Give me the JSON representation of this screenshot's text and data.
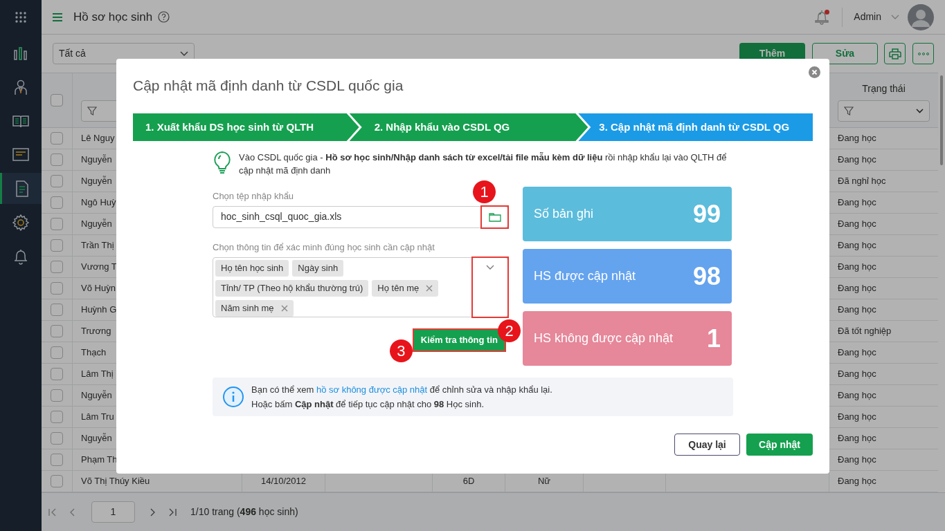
{
  "sidebar": {
    "items": [
      {
        "kind": "chart",
        "selected": false
      },
      {
        "kind": "person",
        "selected": false
      },
      {
        "kind": "book",
        "selected": false
      },
      {
        "kind": "screen",
        "selected": false
      },
      {
        "kind": "document",
        "selected": true
      },
      {
        "kind": "gear",
        "selected": false
      },
      {
        "kind": "bell",
        "selected": false
      }
    ]
  },
  "header": {
    "title": "Hồ sơ học sinh",
    "has_notification": true,
    "user": "Admin"
  },
  "toolbar": {
    "filter": "Tất cả",
    "buttons": [
      {
        "label": "Thêm",
        "primary": true
      },
      {
        "label": "Sửa",
        "primary": false
      }
    ]
  },
  "table": {
    "status_header": "Trạng thái",
    "select_all_checked": false,
    "rows_checked": false,
    "rows": [
      {
        "name": "Lê Nguy",
        "status": "Đang học"
      },
      {
        "name": "Nguyễn",
        "status": "Đang học"
      },
      {
        "name": "Nguyễn",
        "status": "Đã nghỉ học"
      },
      {
        "name": "Ngô Huỳ",
        "status": "Đang học"
      },
      {
        "name": "Nguyễn",
        "status": "Đang học"
      },
      {
        "name": "Trần Thị",
        "status": "Đang học"
      },
      {
        "name": "Vương T",
        "status": "Đang học"
      },
      {
        "name": "Võ Huỳn",
        "status": "Đang học"
      },
      {
        "name": "Huỳnh G",
        "status": "Đang học"
      },
      {
        "name": "Trương",
        "status": "Đã tốt nghiệp"
      },
      {
        "name": "Thạch",
        "status": "Đang học"
      },
      {
        "name": "Lâm Thị",
        "status": "Đang học"
      },
      {
        "name": "Nguyễn",
        "status": "Đang học"
      },
      {
        "name": "Lâm Tru",
        "status": "Đang học"
      },
      {
        "name": "Nguyễn",
        "status": "Đang học"
      },
      {
        "name": "Phạm Th",
        "status": "Đang học"
      },
      {
        "name": "Võ Thị Thúy Kiều",
        "birth_date": "14/10/2012",
        "class": "6D",
        "gender": "Nữ",
        "status": "Đang học"
      }
    ]
  },
  "pagination": {
    "page": "1",
    "summary": "1/10 trang (**496** học sinh)"
  },
  "dialog": {
    "title": "Cập nhật mã định danh từ CSDL quốc gia",
    "steps": [
      {
        "label": "1. Xuất khẩu DS học sinh từ QLTH",
        "selected": false
      },
      {
        "label": "2. Nhập khẩu vào CSDL QG",
        "selected": false
      },
      {
        "label": "3. Cập nhật mã định danh từ CSDL QG",
        "selected": true
      }
    ],
    "tip": "Vào CSDL quốc gia - **Hồ sơ học sinh/Nhập danh sách từ excel/tải file mẫu kèm dữ liệu** rồi nhập khẩu lại vào QLTH để cập nhật mã định danh",
    "file_field": {
      "label": "Chọn tệp nhập khẩu",
      "value": "hoc_sinh_csql_quoc_gia.xls",
      "marker": "1"
    },
    "match_field": {
      "label": "Chọn thông tin để xác minh đúng học sinh cần cập nhật",
      "marker": "2",
      "tags": [
        {
          "label": "Họ tên học sinh",
          "removable": false
        },
        {
          "label": "Ngày sinh",
          "removable": false
        },
        {
          "label": "Tỉnh/ TP (Theo hộ khẩu thường trú)",
          "removable": false
        },
        {
          "label": "Họ tên mẹ",
          "removable": true
        },
        {
          "label": "Năm sinh mẹ",
          "removable": true
        }
      ]
    },
    "check_button": {
      "label": "Kiểm tra thông tin",
      "marker": "3"
    },
    "stats": [
      {
        "label": "Số bản ghi",
        "value": "99",
        "color": "#5bbcdc"
      },
      {
        "label": "HS được cập nhật",
        "value": "98",
        "color": "#64a3ee"
      },
      {
        "label": "HS không được cập nhật",
        "value": "1",
        "color": "#e6879a"
      }
    ],
    "info": {
      "before": "Bạn có thể xem",
      "link": "hồ sơ không được cập nhật",
      "after": "để chỉnh sửa và nhập khẩu lại.",
      "line2": "Hoặc bấm **Cập nhật** để tiếp tục cập nhật cho **98** Học sinh."
    },
    "buttons": [
      {
        "label": "Quay lại",
        "primary": false
      },
      {
        "label": "Cập nhật",
        "primary": true
      }
    ]
  }
}
